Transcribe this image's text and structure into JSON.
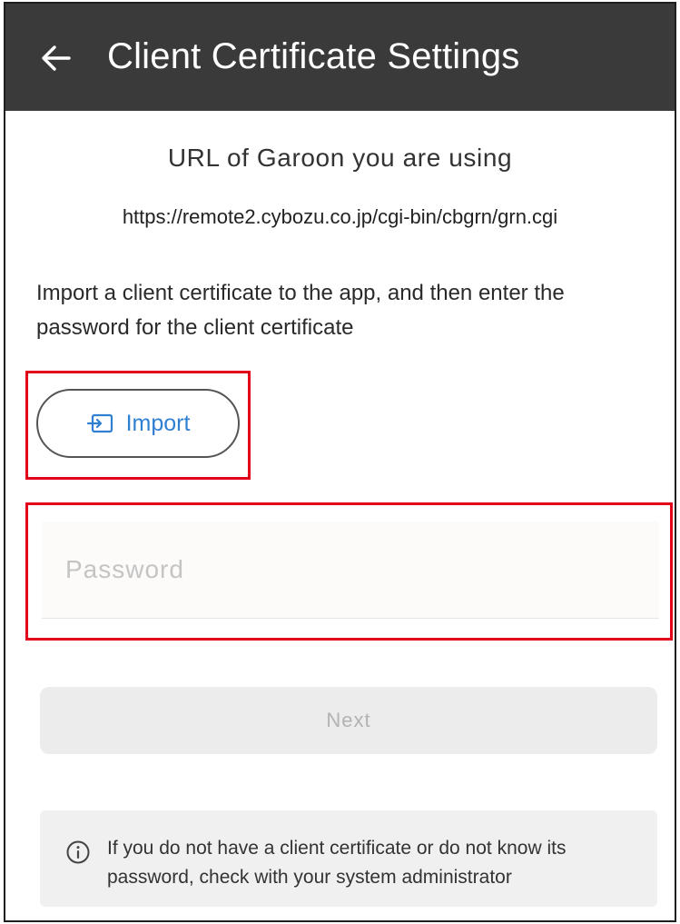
{
  "appbar": {
    "title": "Client Certificate Settings",
    "back_icon": "arrow-left-icon"
  },
  "url_section": {
    "heading": "URL of Garoon you are using",
    "url": "https://remote2.cybozu.co.jp/cgi-bin/cbgrn/grn.cgi"
  },
  "instruction": "Import a client certificate to the app, and then enter the password for the client certificate",
  "import_button": {
    "label": "Import",
    "icon": "import-icon"
  },
  "password": {
    "placeholder": "Password",
    "value": ""
  },
  "next_button": {
    "label": "Next",
    "enabled": false
  },
  "notice": {
    "icon": "info-icon",
    "text": "If you do not have a client certificate or do not know its password, check with your system administrator"
  },
  "colors": {
    "appbar": "#3a3a3a",
    "accent": "#2f7fd2",
    "highlight": "#e3001b"
  }
}
